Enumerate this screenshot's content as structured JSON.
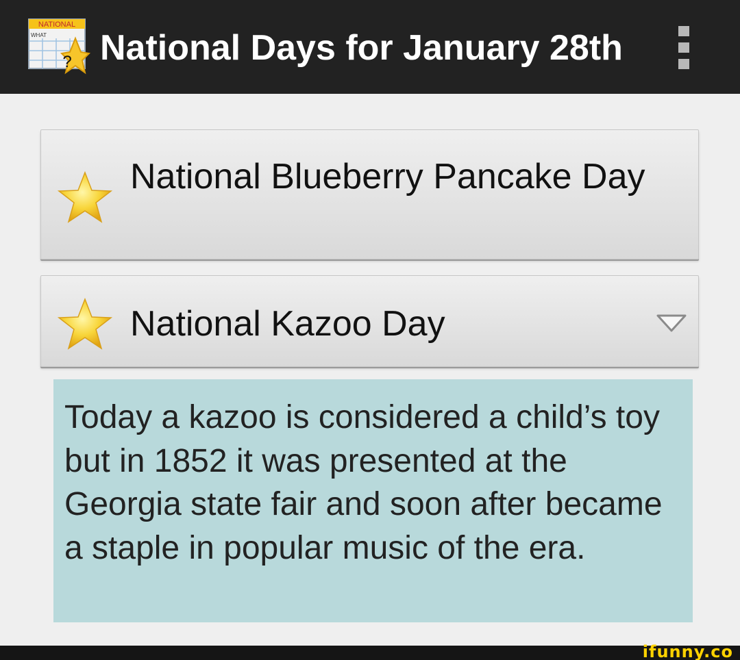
{
  "app": {
    "title": "National Days for January 28th",
    "icon_banner": "NATIONAL",
    "icon_subtext": "WHAT",
    "icon_symbol": "?"
  },
  "days": [
    {
      "label": "National Blueberry Pancake Day",
      "icon": "star-icon",
      "expanded": false
    },
    {
      "label": "National Kazoo Day",
      "icon": "star-icon",
      "expanded": true
    }
  ],
  "description": {
    "text": "Today a kazoo is considered a child’s toy but in 1852 it was presented at the Georgia state fair and soon after became a staple in popular music of the era."
  },
  "watermark": {
    "text": "ifunny.co"
  },
  "colors": {
    "action_bar": "#222222",
    "background": "#efefef",
    "description_panel": "#b8d9db",
    "star": "#f5c518",
    "watermark": "#ffd200"
  }
}
